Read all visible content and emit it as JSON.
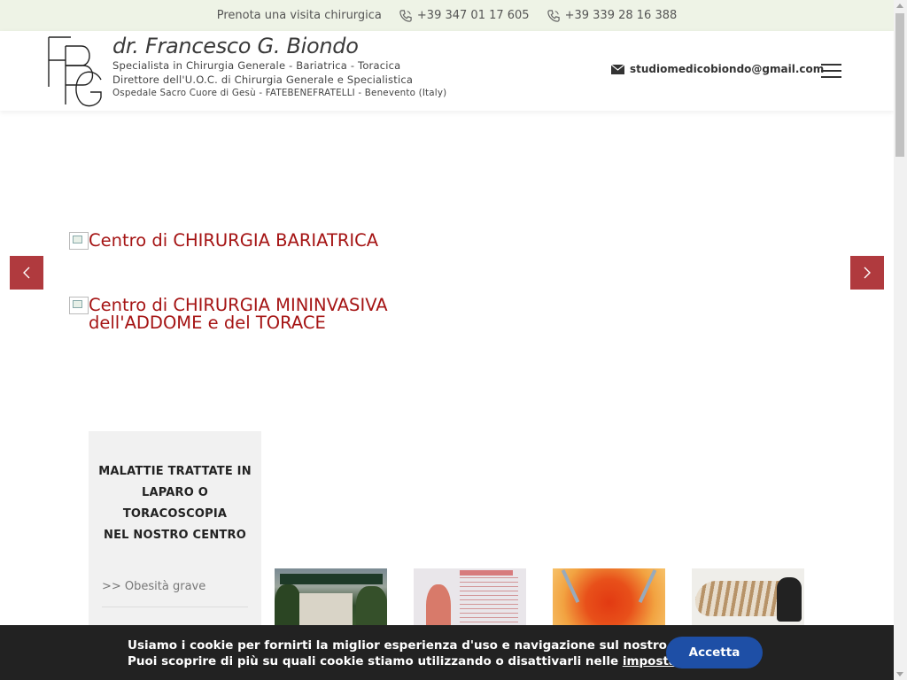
{
  "topbar": {
    "booking_text": "Prenota una visita chirurgica",
    "phone_1": "+39 347 01 17 605",
    "phone_2": "+39 339 28 16 388"
  },
  "header": {
    "logo_name": "dr. Francesco G. Biondo",
    "logo_line_1": "Specialista in Chirurgia Generale - Bariatrica - Toracica",
    "logo_line_2": "Direttore dell'U.O.C. di Chirurgia Generale e Specialistica",
    "logo_line_3": "Ospedale Sacro Cuore di Gesù - FATEBENEFRATELLI - Benevento (Italy)",
    "email": "studiomedicobiondo@gmail.com"
  },
  "slider": {
    "link_1": "Centro di CHIRURGIA BARIATRICA",
    "link_2_line_1": "Centro di CHIRURGIA MININVASIVA",
    "link_2_line_2": "dell'ADDOME e del TORACE"
  },
  "sidebar": {
    "title_line_1": "MALATTIE TRATTATE IN",
    "title_line_2": "LAPARO O",
    "title_line_3": "TORACOSCOPIA",
    "title_line_4": "NEL NOSTRO CENTRO",
    "items": [
      {
        "label": ">> Obesità grave"
      }
    ]
  },
  "cookie": {
    "line_1": "Usiamo i cookie per fornirti la miglior esperienza d'uso e navigazione sul nostro sito web.",
    "line_2_prefix": "Puoi scoprire di più su quali cookie stiamo utilizzando o disattivarli nelle ",
    "line_2_link": "impostazioni.",
    "accept_label": "Accetta"
  },
  "colors": {
    "topbar_bg": "#eef3e6",
    "accent_red": "#a51414",
    "arrow_bg": "#b03a3e",
    "cookie_bg": "#222222",
    "accept_bg": "#1e4fa6"
  },
  "icons": {
    "phone": "phone-icon",
    "email": "envelope-icon",
    "menu": "hamburger-menu-icon",
    "prev": "chevron-left-icon",
    "next": "chevron-right-icon"
  }
}
